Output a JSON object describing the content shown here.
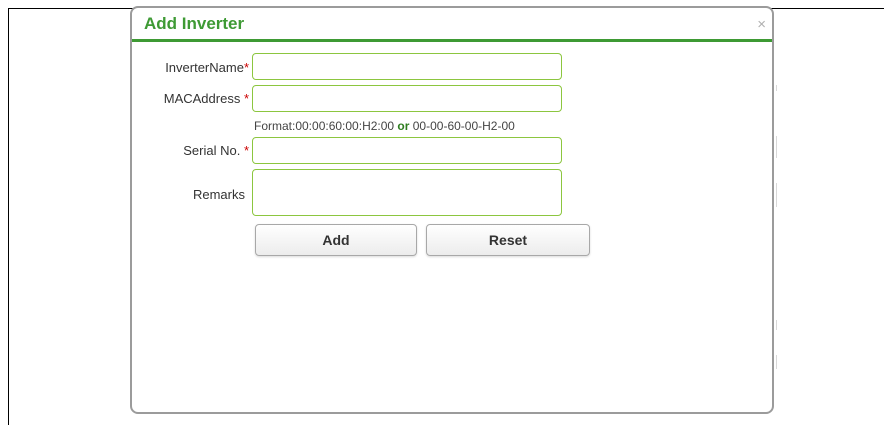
{
  "dialog": {
    "title": "Add Inverter",
    "close_glyph": "×",
    "close_icon": "close-icon"
  },
  "form": {
    "inverter_name": {
      "label": "InverterName",
      "required_mark": "*",
      "value": ""
    },
    "mac_address": {
      "label": "MACAddress ",
      "required_mark": "*",
      "value": "",
      "hint_prefix": "Format:00:00:60:00:H2:00 ",
      "hint_or": "or",
      "hint_suffix": " 00-00-60-00-H2-00"
    },
    "serial_no": {
      "label": "Serial No. ",
      "required_mark": "*",
      "value": ""
    },
    "remarks": {
      "label": "Remarks",
      "value": ""
    }
  },
  "buttons": {
    "add_label": "Add",
    "reset_label": "Reset"
  },
  "colors": {
    "title_green": "#3e9a34",
    "input_border_green": "#8cc63f",
    "required_red": "#cc0000"
  }
}
